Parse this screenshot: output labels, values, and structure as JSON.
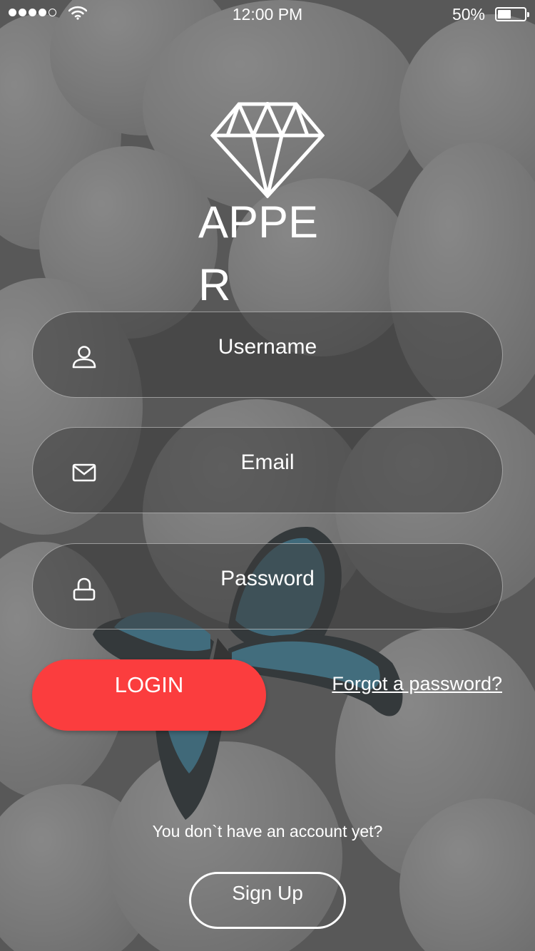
{
  "status_bar": {
    "time": "12:00 PM",
    "battery_percent": "50%",
    "battery_level": 0.5,
    "signal_bars": 4,
    "signal_max": 5
  },
  "logo": {
    "icon": "diamond-icon",
    "text": "APPER"
  },
  "form": {
    "username": {
      "placeholder": "Username",
      "value": "",
      "icon": "user-icon"
    },
    "email": {
      "placeholder": "Email",
      "value": "",
      "icon": "mail-icon"
    },
    "password": {
      "placeholder": "Password",
      "value": "",
      "icon": "lock-icon"
    }
  },
  "actions": {
    "login_label": "LOGIN",
    "forgot_label": "Forgot a password?",
    "no_account_text": "You don`t have an account yet?",
    "signup_label": "Sign Up"
  },
  "colors": {
    "accent": "#fb3d3e",
    "text": "#ffffff"
  }
}
